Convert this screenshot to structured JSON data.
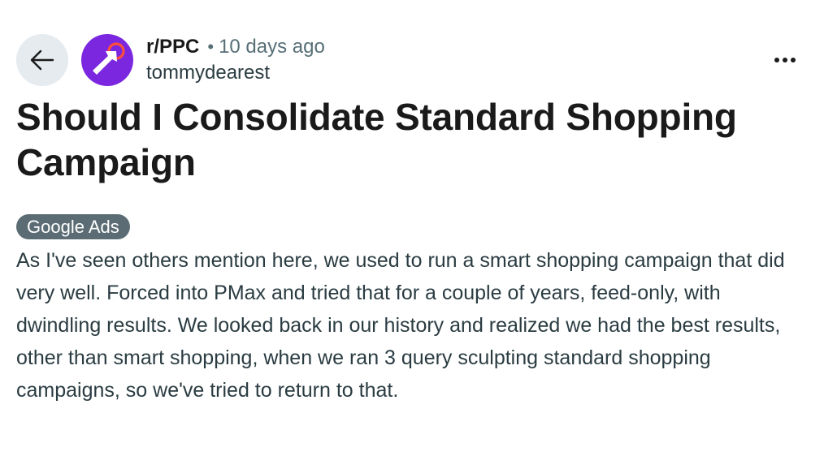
{
  "header": {
    "back_icon": "arrow-left-icon",
    "avatar_icon": "cursor-target-icon",
    "subreddit": "r/PPC",
    "separator": "•",
    "timestamp": "10 days ago",
    "author": "tommydearest",
    "overflow_icon": "more-horizontal-icon"
  },
  "post": {
    "title": "Should I Consolidate Standard Shopping Campaign",
    "flair": "Google Ads",
    "body": "As I've seen others mention here, we used to run a smart shopping campaign that did very well. Forced into PMax and tried that for a couple of years, feed-only, with dwindling results. We looked back in our history and realized we had the best results, other than smart shopping, when we ran 3 query sculpting standard shopping campaigns, so we've tried to return to that."
  },
  "colors": {
    "avatar_bg": "#7b27e0",
    "avatar_accent": "#ff4f3b",
    "flair_bg": "#5c6c74",
    "back_button_bg": "#e5ebee"
  }
}
